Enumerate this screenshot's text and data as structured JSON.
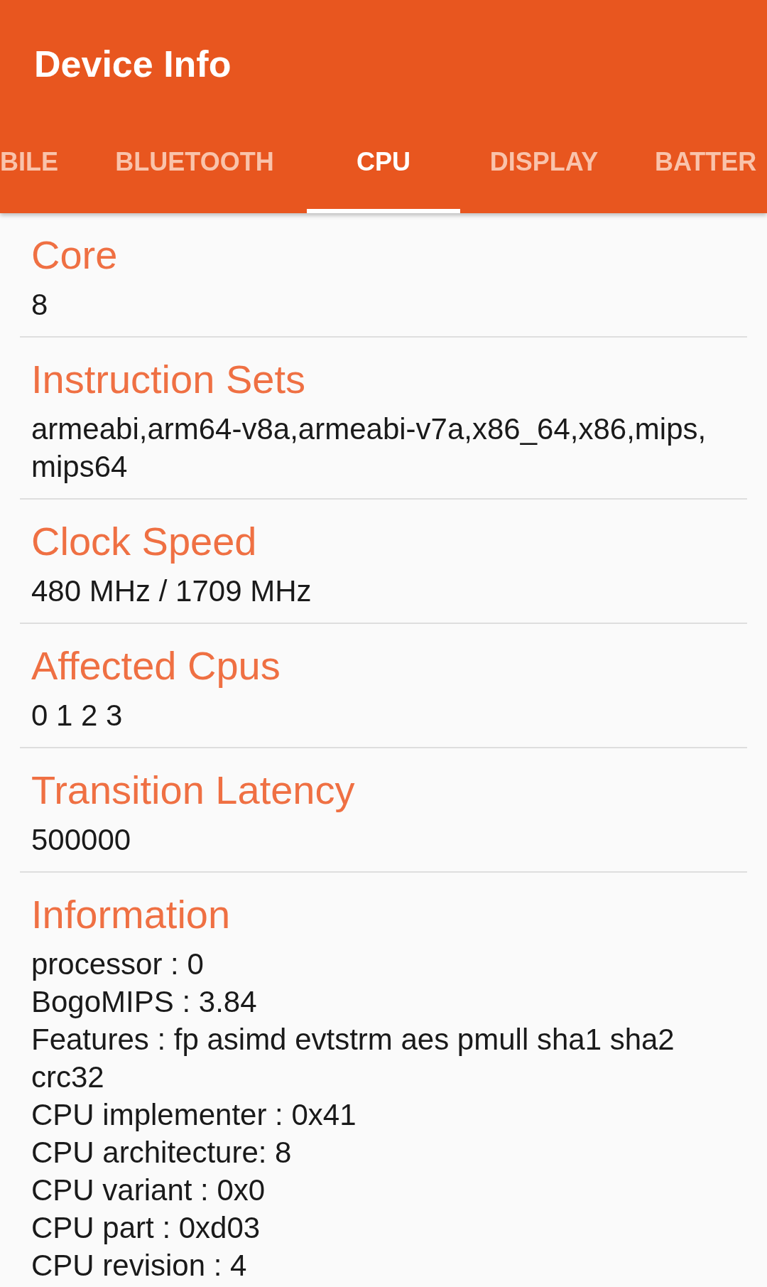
{
  "app_bar": {
    "title": "Device Info"
  },
  "tabs": [
    {
      "label": "BILE",
      "selected": false
    },
    {
      "label": "BLUETOOTH",
      "selected": false
    },
    {
      "label": "CPU",
      "selected": true
    },
    {
      "label": "DISPLAY",
      "selected": false
    },
    {
      "label": "BATTER",
      "selected": false
    }
  ],
  "sections": [
    {
      "heading": "Core",
      "lines": [
        "8"
      ]
    },
    {
      "heading": "Instruction Sets",
      "lines": [
        "armeabi,arm64-v8a,armeabi-v7a,x86_64,x86,mips,mips64"
      ]
    },
    {
      "heading": "Clock Speed",
      "lines": [
        "480 MHz / 1709 MHz"
      ]
    },
    {
      "heading": "Affected Cpus",
      "lines": [
        "0 1 2 3"
      ]
    },
    {
      "heading": "Transition Latency",
      "lines": [
        "500000"
      ]
    },
    {
      "heading": "Information",
      "lines": [
        "processor : 0",
        "BogoMIPS : 3.84",
        "Features : fp asimd evtstrm aes pmull sha1 sha2 crc32",
        "CPU implementer : 0x41",
        "CPU architecture: 8",
        "CPU variant : 0x0",
        "CPU part : 0xd03",
        "CPU revision : 4"
      ]
    }
  ]
}
